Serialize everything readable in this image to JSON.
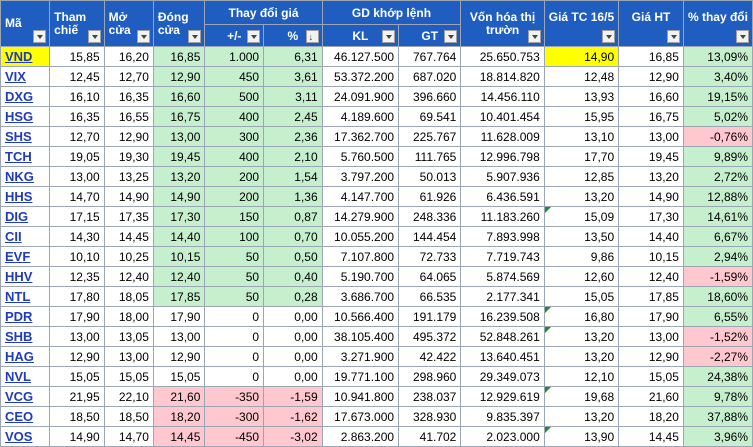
{
  "headers": {
    "ma": "Mã",
    "tham_chieu": "Tham chiế",
    "mo_cua": "Mở cửa",
    "dong_cua": "Đóng cửa",
    "thay_doi_gia": "Thay đổi giá",
    "thay_doi_abs": "+/-",
    "thay_doi_pct": "%",
    "gd_khop_lenh": "GD khớp lệnh",
    "kl": "KL",
    "gt": "GT",
    "von_hoa": "Vốn hóa thị trườn",
    "gia_tc": "Giá TC 16/5",
    "gia_ht": "Giá HT",
    "pct_thay_doi": "% thay đổi"
  },
  "rows": [
    {
      "sym": "VND",
      "ref": "15,85",
      "open": "16,20",
      "close": "16,85",
      "chg": "1.000",
      "pct": "6,31",
      "kl": "46.127.500",
      "gt": "767.764",
      "cap": "25.650.753",
      "tc": "14,90",
      "ht": "16,85",
      "pchg": "13,09%",
      "cstate": "pos",
      "pstate": "pos",
      "hl": true,
      "tri": false
    },
    {
      "sym": "VIX",
      "ref": "12,45",
      "open": "12,70",
      "close": "12,90",
      "chg": "450",
      "pct": "3,61",
      "kl": "53.372.200",
      "gt": "687.020",
      "cap": "18.814.820",
      "tc": "12,48",
      "ht": "12,90",
      "pchg": "3,40%",
      "cstate": "pos",
      "pstate": "pos",
      "hl": false,
      "tri": false
    },
    {
      "sym": "DXG",
      "ref": "16,10",
      "open": "16,35",
      "close": "16,60",
      "chg": "500",
      "pct": "3,11",
      "kl": "24.091.900",
      "gt": "396.660",
      "cap": "14.456.110",
      "tc": "13,93",
      "ht": "16,60",
      "pchg": "19,15%",
      "cstate": "pos",
      "pstate": "pos",
      "hl": false,
      "tri": false
    },
    {
      "sym": "HSG",
      "ref": "16,35",
      "open": "16,55",
      "close": "16,75",
      "chg": "400",
      "pct": "2,45",
      "kl": "4.189.600",
      "gt": "69.541",
      "cap": "10.401.454",
      "tc": "15,95",
      "ht": "16,75",
      "pchg": "5,02%",
      "cstate": "pos",
      "pstate": "pos",
      "hl": false,
      "tri": false
    },
    {
      "sym": "SHS",
      "ref": "12,70",
      "open": "12,90",
      "close": "13,00",
      "chg": "300",
      "pct": "2,36",
      "kl": "17.362.700",
      "gt": "225.767",
      "cap": "11.628.009",
      "tc": "13,10",
      "ht": "13,00",
      "pchg": "-0,76%",
      "cstate": "pos",
      "pstate": "neg",
      "hl": false,
      "tri": false
    },
    {
      "sym": "TCH",
      "ref": "19,05",
      "open": "19,30",
      "close": "19,45",
      "chg": "400",
      "pct": "2,10",
      "kl": "5.760.500",
      "gt": "111.765",
      "cap": "12.996.798",
      "tc": "17,70",
      "ht": "19,45",
      "pchg": "9,89%",
      "cstate": "pos",
      "pstate": "pos",
      "hl": false,
      "tri": false
    },
    {
      "sym": "NKG",
      "ref": "13,00",
      "open": "13,25",
      "close": "13,20",
      "chg": "200",
      "pct": "1,54",
      "kl": "3.797.200",
      "gt": "50.013",
      "cap": "5.907.936",
      "tc": "12,85",
      "ht": "13,20",
      "pchg": "2,72%",
      "cstate": "pos",
      "pstate": "pos",
      "hl": false,
      "tri": false
    },
    {
      "sym": "HHS",
      "ref": "14,70",
      "open": "14,90",
      "close": "14,90",
      "chg": "200",
      "pct": "1,36",
      "kl": "4.147.700",
      "gt": "61.926",
      "cap": "6.436.591",
      "tc": "13,20",
      "ht": "14,90",
      "pchg": "12,88%",
      "cstate": "pos",
      "pstate": "pos",
      "hl": false,
      "tri": false
    },
    {
      "sym": "DIG",
      "ref": "17,15",
      "open": "17,35",
      "close": "17,30",
      "chg": "150",
      "pct": "0,87",
      "kl": "14.279.900",
      "gt": "248.336",
      "cap": "11.183.260",
      "tc": "15,09",
      "ht": "17,30",
      "pchg": "14,61%",
      "cstate": "pos",
      "pstate": "pos",
      "hl": false,
      "tri": true
    },
    {
      "sym": "CII",
      "ref": "14,30",
      "open": "14,45",
      "close": "14,40",
      "chg": "100",
      "pct": "0,70",
      "kl": "10.055.200",
      "gt": "144.454",
      "cap": "7.893.998",
      "tc": "13,50",
      "ht": "14,40",
      "pchg": "6,67%",
      "cstate": "pos",
      "pstate": "pos",
      "hl": false,
      "tri": false
    },
    {
      "sym": "EVF",
      "ref": "10,10",
      "open": "10,25",
      "close": "10,15",
      "chg": "50",
      "pct": "0,50",
      "kl": "7.107.800",
      "gt": "72.733",
      "cap": "7.719.743",
      "tc": "9,86",
      "ht": "10,15",
      "pchg": "2,94%",
      "cstate": "pos",
      "pstate": "pos",
      "hl": false,
      "tri": false
    },
    {
      "sym": "HHV",
      "ref": "12,35",
      "open": "12,40",
      "close": "12,40",
      "chg": "50",
      "pct": "0,40",
      "kl": "5.190.700",
      "gt": "64.065",
      "cap": "5.874.569",
      "tc": "12,60",
      "ht": "12,40",
      "pchg": "-1,59%",
      "cstate": "pos",
      "pstate": "neg",
      "hl": false,
      "tri": false
    },
    {
      "sym": "NTL",
      "ref": "17,80",
      "open": "18,05",
      "close": "17,85",
      "chg": "50",
      "pct": "0,28",
      "kl": "3.686.700",
      "gt": "66.535",
      "cap": "2.177.341",
      "tc": "15,05",
      "ht": "17,85",
      "pchg": "18,60%",
      "cstate": "pos",
      "pstate": "pos",
      "hl": false,
      "tri": false
    },
    {
      "sym": "PDR",
      "ref": "17,90",
      "open": "18,00",
      "close": "17,90",
      "chg": "0",
      "pct": "0,00",
      "kl": "10.566.400",
      "gt": "191.179",
      "cap": "16.239.508",
      "tc": "16,80",
      "ht": "17,90",
      "pchg": "6,55%",
      "cstate": "",
      "pstate": "pos",
      "hl": false,
      "tri": true
    },
    {
      "sym": "SHB",
      "ref": "13,00",
      "open": "13,05",
      "close": "13,00",
      "chg": "0",
      "pct": "0,00",
      "kl": "38.105.400",
      "gt": "495.372",
      "cap": "52.848.261",
      "tc": "13,20",
      "ht": "13,00",
      "pchg": "-1,52%",
      "cstate": "",
      "pstate": "neg",
      "hl": false,
      "tri": true
    },
    {
      "sym": "HAG",
      "ref": "12,90",
      "open": "13,00",
      "close": "12,90",
      "chg": "0",
      "pct": "0,00",
      "kl": "3.271.900",
      "gt": "42.422",
      "cap": "13.640.451",
      "tc": "13,20",
      "ht": "12,90",
      "pchg": "-2,27%",
      "cstate": "",
      "pstate": "neg",
      "hl": false,
      "tri": false
    },
    {
      "sym": "NVL",
      "ref": "15,05",
      "open": "15,05",
      "close": "15,05",
      "chg": "0",
      "pct": "0,00",
      "kl": "19.771.100",
      "gt": "298.960",
      "cap": "29.349.073",
      "tc": "12,10",
      "ht": "15,05",
      "pchg": "24,38%",
      "cstate": "",
      "pstate": "pos",
      "hl": false,
      "tri": false
    },
    {
      "sym": "VCG",
      "ref": "21,95",
      "open": "22,10",
      "close": "21,60",
      "chg": "-350",
      "pct": "-1,59",
      "kl": "10.941.800",
      "gt": "238.037",
      "cap": "12.929.619",
      "tc": "19,68",
      "ht": "21,60",
      "pchg": "9,78%",
      "cstate": "neg",
      "pstate": "pos",
      "hl": false,
      "tri": true
    },
    {
      "sym": "CEO",
      "ref": "18,50",
      "open": "18,50",
      "close": "18,20",
      "chg": "-300",
      "pct": "-1,62",
      "kl": "17.673.000",
      "gt": "328.930",
      "cap": "9.835.397",
      "tc": "13,20",
      "ht": "18,20",
      "pchg": "37,88%",
      "cstate": "neg",
      "pstate": "pos",
      "hl": false,
      "tri": false
    },
    {
      "sym": "VOS",
      "ref": "14,90",
      "open": "14,70",
      "close": "14,45",
      "chg": "-450",
      "pct": "-3,02",
      "kl": "2.863.200",
      "gt": "41.702",
      "cap": "2.023.000",
      "tc": "13,90",
      "ht": "14,45",
      "pchg": "3,96%",
      "cstate": "neg",
      "pstate": "pos",
      "hl": false,
      "tri": true
    }
  ]
}
